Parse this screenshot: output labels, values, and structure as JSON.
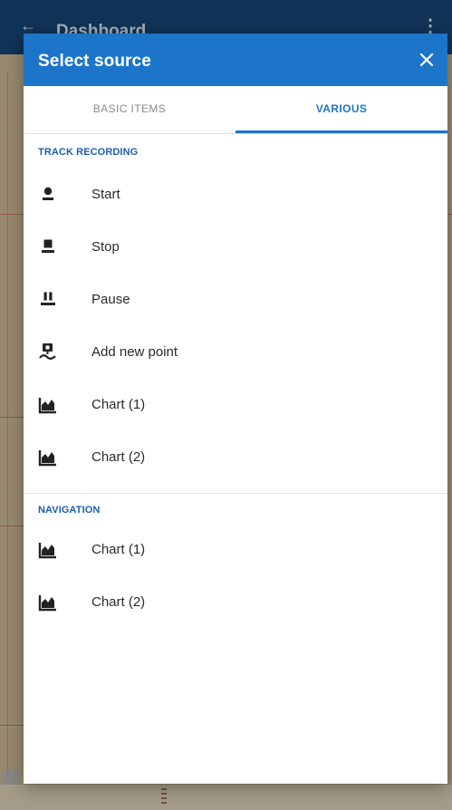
{
  "background": {
    "app_title": "Dashboard"
  },
  "dialog": {
    "title": "Select source",
    "close_icon": "close-icon",
    "tabs": [
      {
        "label": "BASIC ITEMS",
        "selected": false
      },
      {
        "label": "VARIOUS",
        "selected": true
      }
    ]
  },
  "sections": {
    "track_recording": {
      "title": "TRACK RECORDING",
      "items": [
        {
          "label": "Start",
          "icon": "record-start-icon"
        },
        {
          "label": "Stop",
          "icon": "record-stop-icon"
        },
        {
          "label": "Pause",
          "icon": "record-pause-icon"
        },
        {
          "label": "Add new point",
          "icon": "add-point-icon"
        },
        {
          "label": "Chart (1)",
          "icon": "chart-icon"
        },
        {
          "label": "Chart (2)",
          "icon": "chart-icon"
        }
      ]
    },
    "navigation": {
      "title": "NAVIGATION",
      "items": [
        {
          "label": "Chart (1)",
          "icon": "chart-icon"
        },
        {
          "label": "Chart (2)",
          "icon": "chart-icon"
        }
      ]
    }
  },
  "colors": {
    "primary": "#1c75c9",
    "section_header": "#1c5fae",
    "tab_inactive": "#8a8a8a",
    "item_text": "#2a2a2a"
  }
}
